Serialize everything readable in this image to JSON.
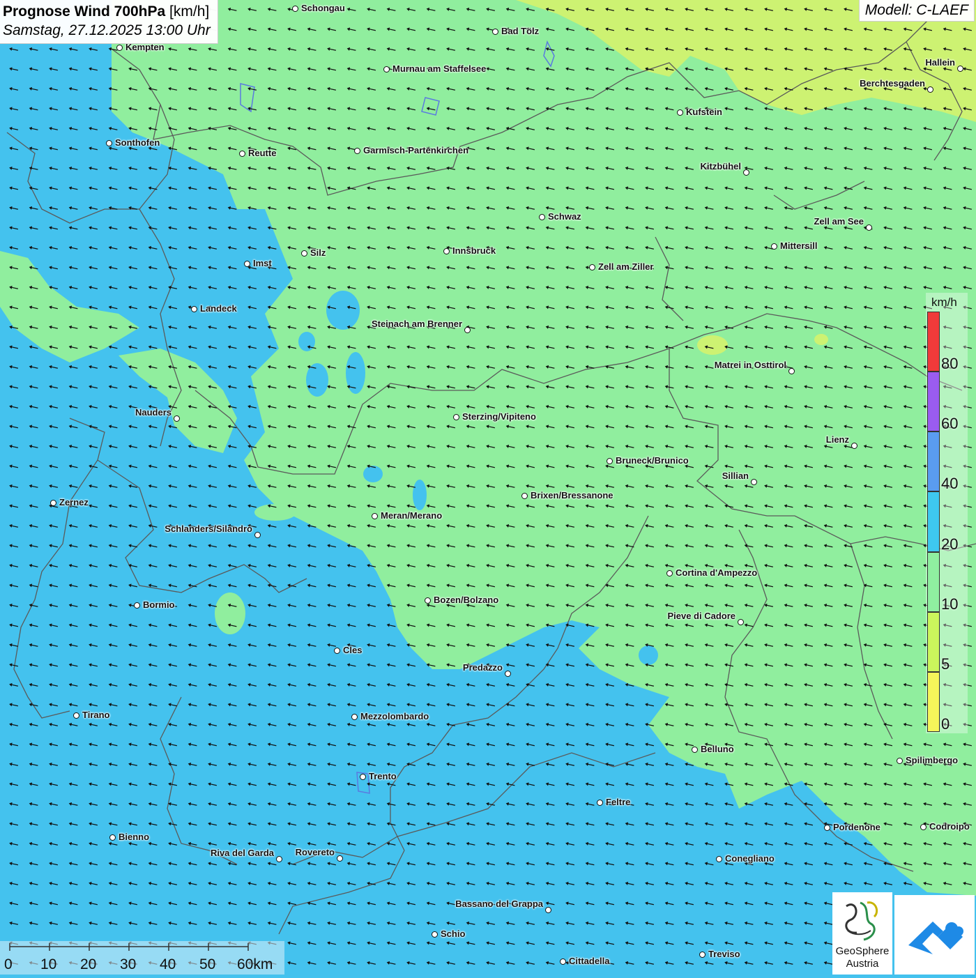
{
  "header": {
    "title_bold": "Prognose Wind 700hPa",
    "title_unit": "[km/h]",
    "datetime": "Samstag, 27.12.2025 13:00 Uhr"
  },
  "model": "Modell: C-LAEF",
  "legend": {
    "unit": "km/h",
    "ticks": [
      "0",
      "5",
      "10",
      "20",
      "40",
      "60",
      "80"
    ],
    "colors": [
      "#f5f55a",
      "#cbf55c",
      "#8fefa0",
      "#3ec8f0",
      "#5a9cf0",
      "#9a5cf0",
      "#f03a3a"
    ]
  },
  "scale": {
    "labels": [
      "0",
      "10",
      "20",
      "30",
      "40",
      "50",
      "60km"
    ]
  },
  "colors": {
    "land_green": "#90ee9e",
    "low_yellow_green": "#cdf272",
    "water_blue": "#44c2ee",
    "border": "#5a5a5a"
  },
  "cities": [
    {
      "name": "Schongau"
    },
    {
      "name": "Bad Tölz"
    },
    {
      "name": "Kempten"
    },
    {
      "name": "Murnau am Staffelsee"
    },
    {
      "name": "Hallein"
    },
    {
      "name": "Berchtesgaden"
    },
    {
      "name": "Kufstein"
    },
    {
      "name": "Sonthofen"
    },
    {
      "name": "Reutte"
    },
    {
      "name": "Garmisch-Partenkirchen"
    },
    {
      "name": "Kitzbühel"
    },
    {
      "name": "Schwaz"
    },
    {
      "name": "Zell am See"
    },
    {
      "name": "Mittersill"
    },
    {
      "name": "Imst"
    },
    {
      "name": "Silz"
    },
    {
      "name": "Innsbruck"
    },
    {
      "name": "Zell am Ziller"
    },
    {
      "name": "Landeck"
    },
    {
      "name": "Steinach am Brenner"
    },
    {
      "name": "Matrei in Osttirol"
    },
    {
      "name": "Nauders"
    },
    {
      "name": "Sterzing/Vipiteno"
    },
    {
      "name": "Lienz"
    },
    {
      "name": "Bruneck/Brunico"
    },
    {
      "name": "Sillian"
    },
    {
      "name": "Zernez"
    },
    {
      "name": "Brixen/Bressanone"
    },
    {
      "name": "Meran/Merano"
    },
    {
      "name": "Schlanders/Silandro"
    },
    {
      "name": "Cortina d'Ampezzo"
    },
    {
      "name": "Bozen/Bolzano"
    },
    {
      "name": "Bormio"
    },
    {
      "name": "Pieve di Cadore"
    },
    {
      "name": "Cles"
    },
    {
      "name": "Predazzo"
    },
    {
      "name": "Tirano"
    },
    {
      "name": "Mezzolombardo"
    },
    {
      "name": "Belluno"
    },
    {
      "name": "Spilimbergo"
    },
    {
      "name": "Trento"
    },
    {
      "name": "Feltre"
    },
    {
      "name": "Pordenone"
    },
    {
      "name": "Codroipo"
    },
    {
      "name": "Bienno"
    },
    {
      "name": "Riva del Garda"
    },
    {
      "name": "Rovereto"
    },
    {
      "name": "Conegliano"
    },
    {
      "name": "Bassano del Grappa"
    },
    {
      "name": "Schio"
    },
    {
      "name": "Treviso"
    },
    {
      "name": "Cittadella"
    }
  ],
  "logos": {
    "geosphere_line1": "GeoSphere",
    "geosphere_line2": "Austria"
  }
}
